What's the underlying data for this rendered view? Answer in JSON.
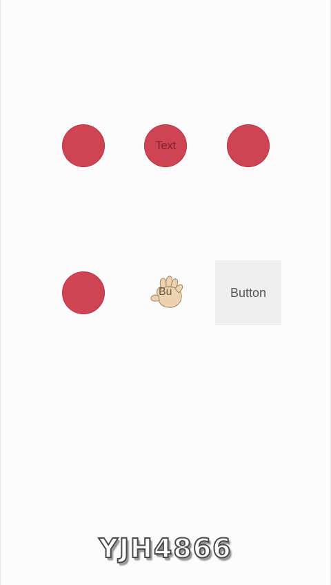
{
  "buttons": {
    "top_row": [
      {
        "label": ""
      },
      {
        "label": "Text"
      },
      {
        "label": ""
      }
    ],
    "bottom_row": [
      {
        "label": ""
      },
      {
        "label": "Bu"
      },
      {
        "label": "Button"
      }
    ]
  },
  "watermark": "YJH4866",
  "colors": {
    "circle": "#cf4452",
    "square": "#efeeef",
    "background": "#fdfcfd"
  },
  "icons": {
    "hand": "raised-hand-icon"
  }
}
